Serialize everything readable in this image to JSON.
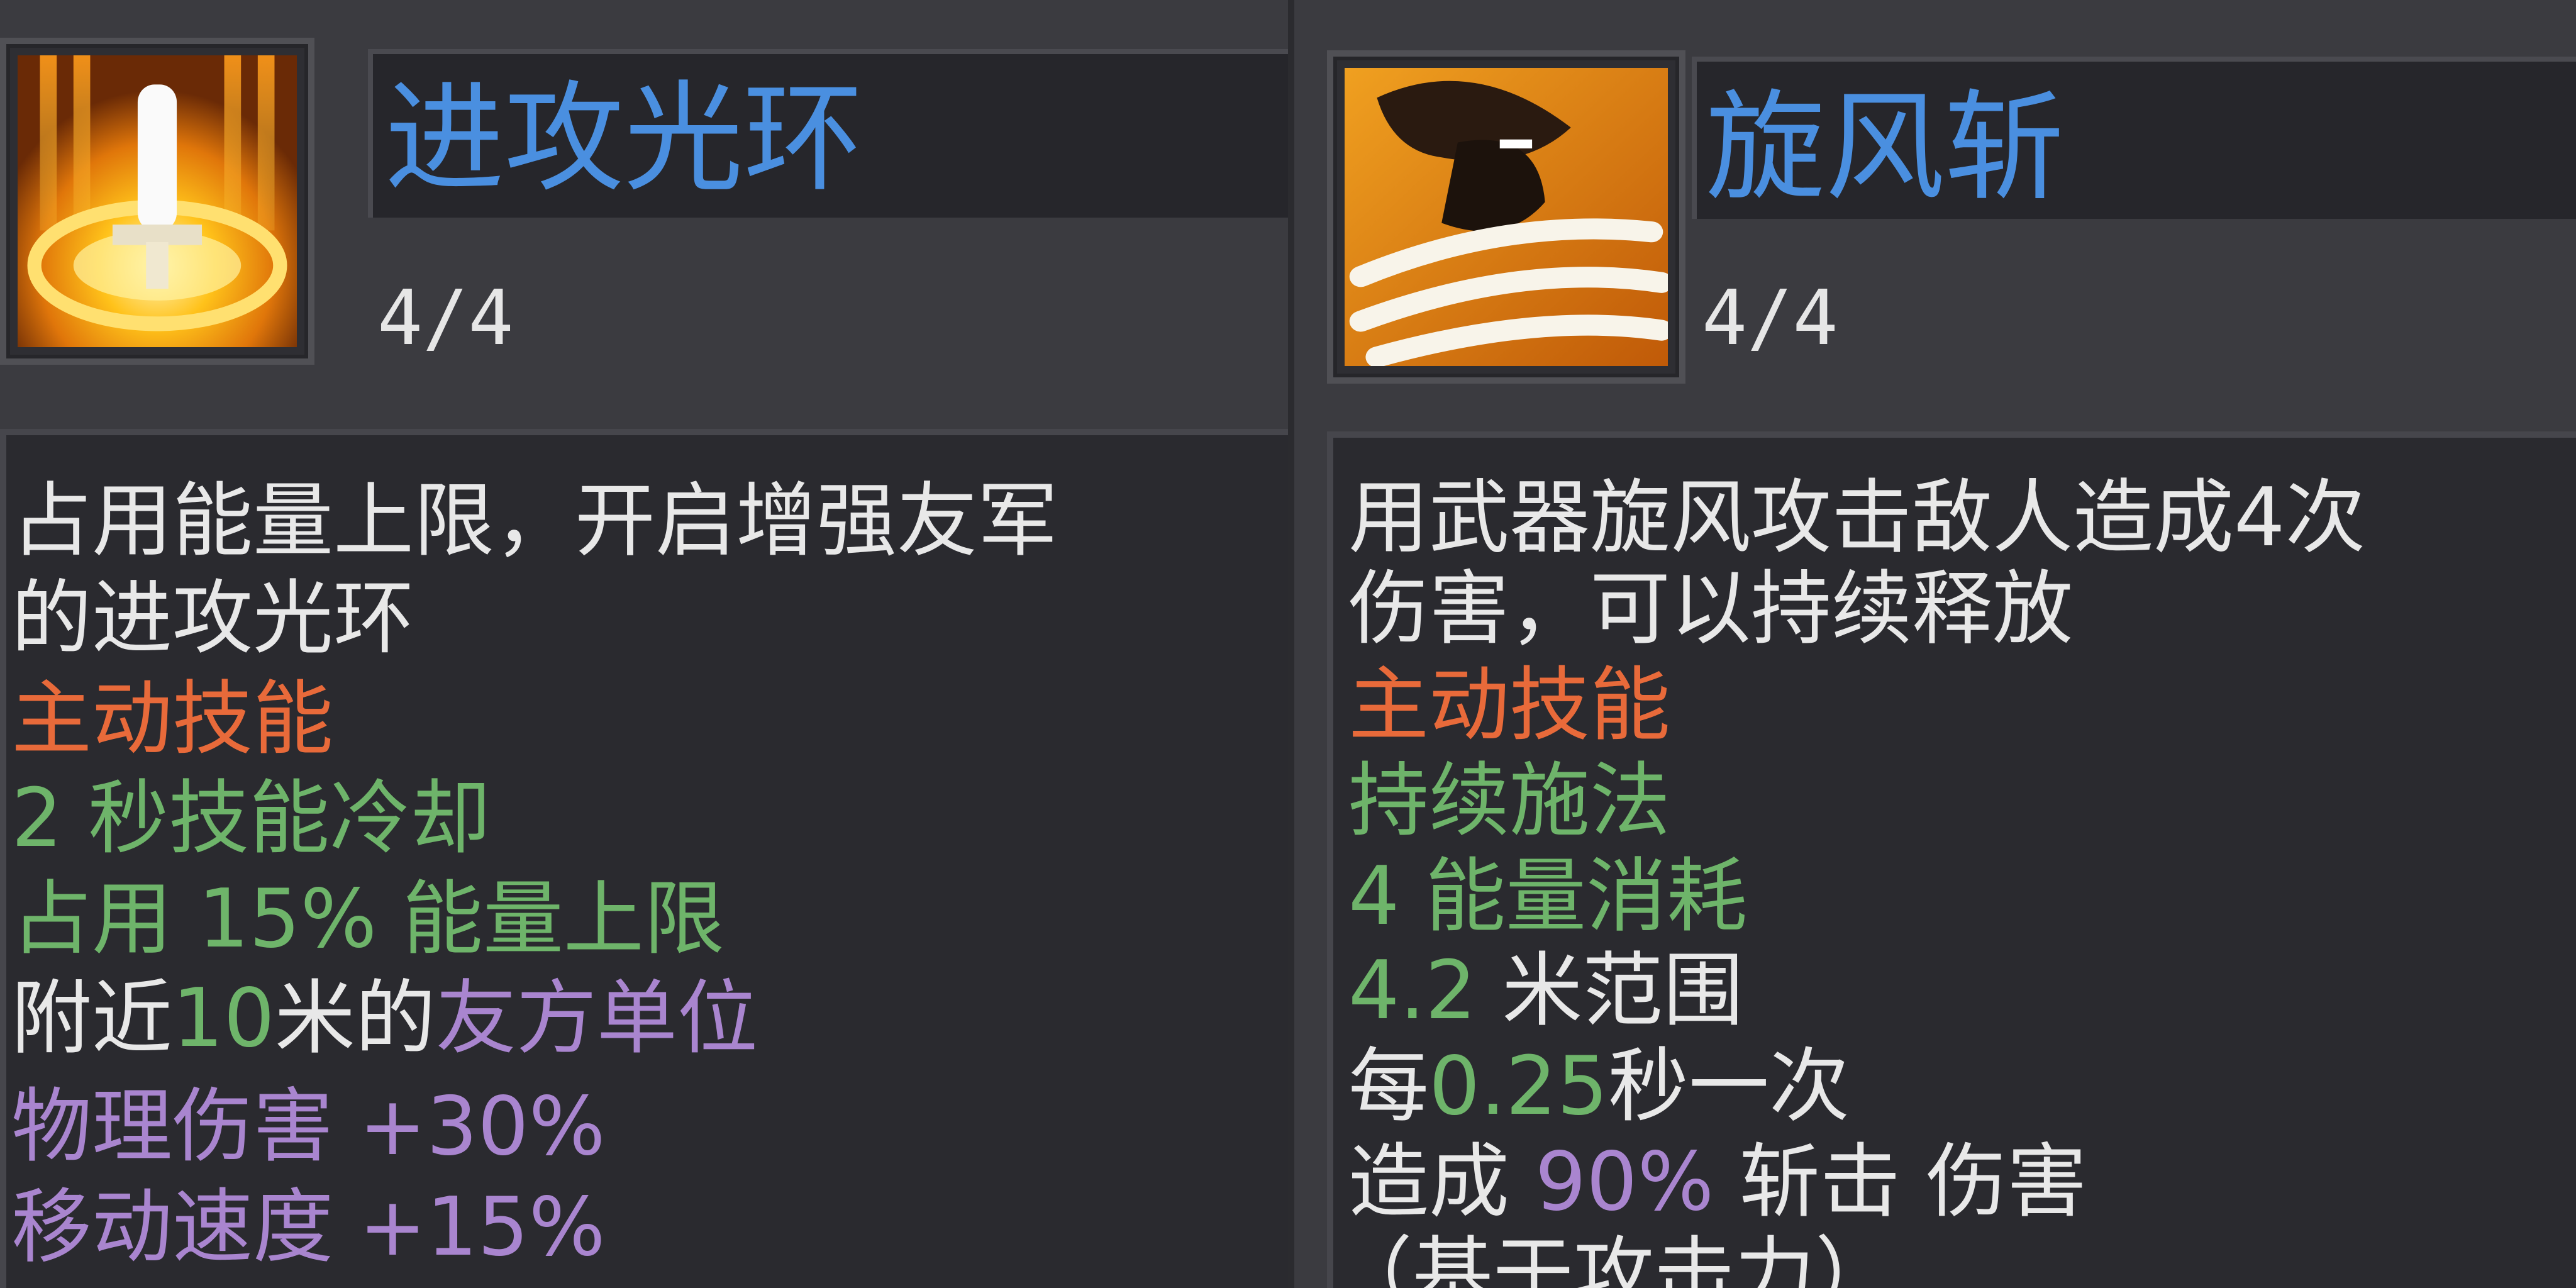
{
  "colors": {
    "title": "#4a8fe0",
    "white": "#e8e8e8",
    "orange": "#e86a3a",
    "green": "#6eb46a",
    "purple": "#a985cf"
  },
  "left": {
    "icon": "sword-aura-icon",
    "title": "进攻光环",
    "level": "4/4",
    "desc_line1": "占用能量上限，开启增强友军",
    "desc_line2": "的进攻光环",
    "type": "主动技能",
    "cooldown": "2 秒技能冷却",
    "occupy_a": "占用 ",
    "occupy_b": "15% 能量上限",
    "nearby_a": "附近",
    "nearby_b": "10",
    "nearby_c": "米的",
    "nearby_d": "友方单位",
    "stat1": "物理伤害 +30%",
    "stat2": "移动速度 +15%"
  },
  "right": {
    "icon": "whirlwind-slash-icon",
    "title": "旋风斩",
    "level": "4/4",
    "desc_line1": "用武器旋风攻击敌人造成4次",
    "desc_line2": "伤害，可以持续释放",
    "type": "主动技能",
    "channel": "持续施法",
    "energy": "4 能量消耗",
    "range_a": "4.2",
    "range_b": " 米范围",
    "freq_a": "每",
    "freq_b": "0.25",
    "freq_c": "秒一次",
    "damage_a": "造成 ",
    "damage_b": "90%",
    "damage_c": " 斩击 伤害",
    "note": "（基于攻击力）"
  }
}
